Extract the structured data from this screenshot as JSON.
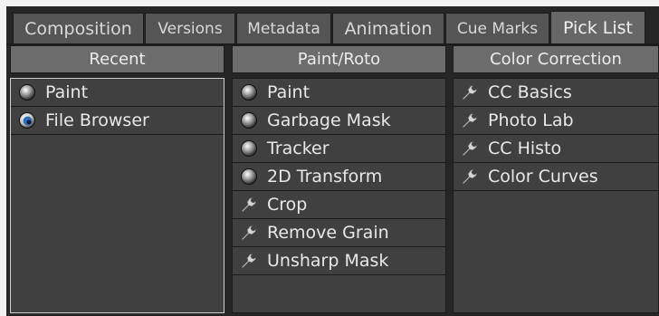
{
  "tabs": [
    {
      "label": "Composition",
      "active": false
    },
    {
      "label": "Versions",
      "active": false
    },
    {
      "label": "Metadata",
      "active": false
    },
    {
      "label": "Animation",
      "active": false
    },
    {
      "label": "Cue Marks",
      "active": false
    },
    {
      "label": "Pick List",
      "active": true
    }
  ],
  "columns": [
    {
      "header": "Recent",
      "items": [
        {
          "label": "Paint",
          "icon": "radio-icon",
          "selected": false
        },
        {
          "label": "File Browser",
          "icon": "radio-selected-icon",
          "selected": true
        }
      ]
    },
    {
      "header": "Paint/Roto",
      "items": [
        {
          "label": "Paint",
          "icon": "radio-icon"
        },
        {
          "label": "Garbage Mask",
          "icon": "radio-icon"
        },
        {
          "label": "Tracker",
          "icon": "radio-icon"
        },
        {
          "label": "2D Transform",
          "icon": "radio-icon"
        },
        {
          "label": "Crop",
          "icon": "wrench-icon"
        },
        {
          "label": "Remove Grain",
          "icon": "wrench-icon"
        },
        {
          "label": "Unsharp Mask",
          "icon": "wrench-icon"
        }
      ]
    },
    {
      "header": "Color Correction",
      "items": [
        {
          "label": "CC Basics",
          "icon": "wrench-icon"
        },
        {
          "label": "Photo Lab",
          "icon": "wrench-icon"
        },
        {
          "label": "CC Histo",
          "icon": "wrench-icon"
        },
        {
          "label": "Color Curves",
          "icon": "wrench-icon"
        }
      ]
    }
  ],
  "colors": {
    "background": "#262626",
    "tab": "#555555",
    "tab_active": "#676767",
    "header": "#6c6c6c",
    "list": "#404040",
    "selected_radio": "#2e6fb5"
  }
}
